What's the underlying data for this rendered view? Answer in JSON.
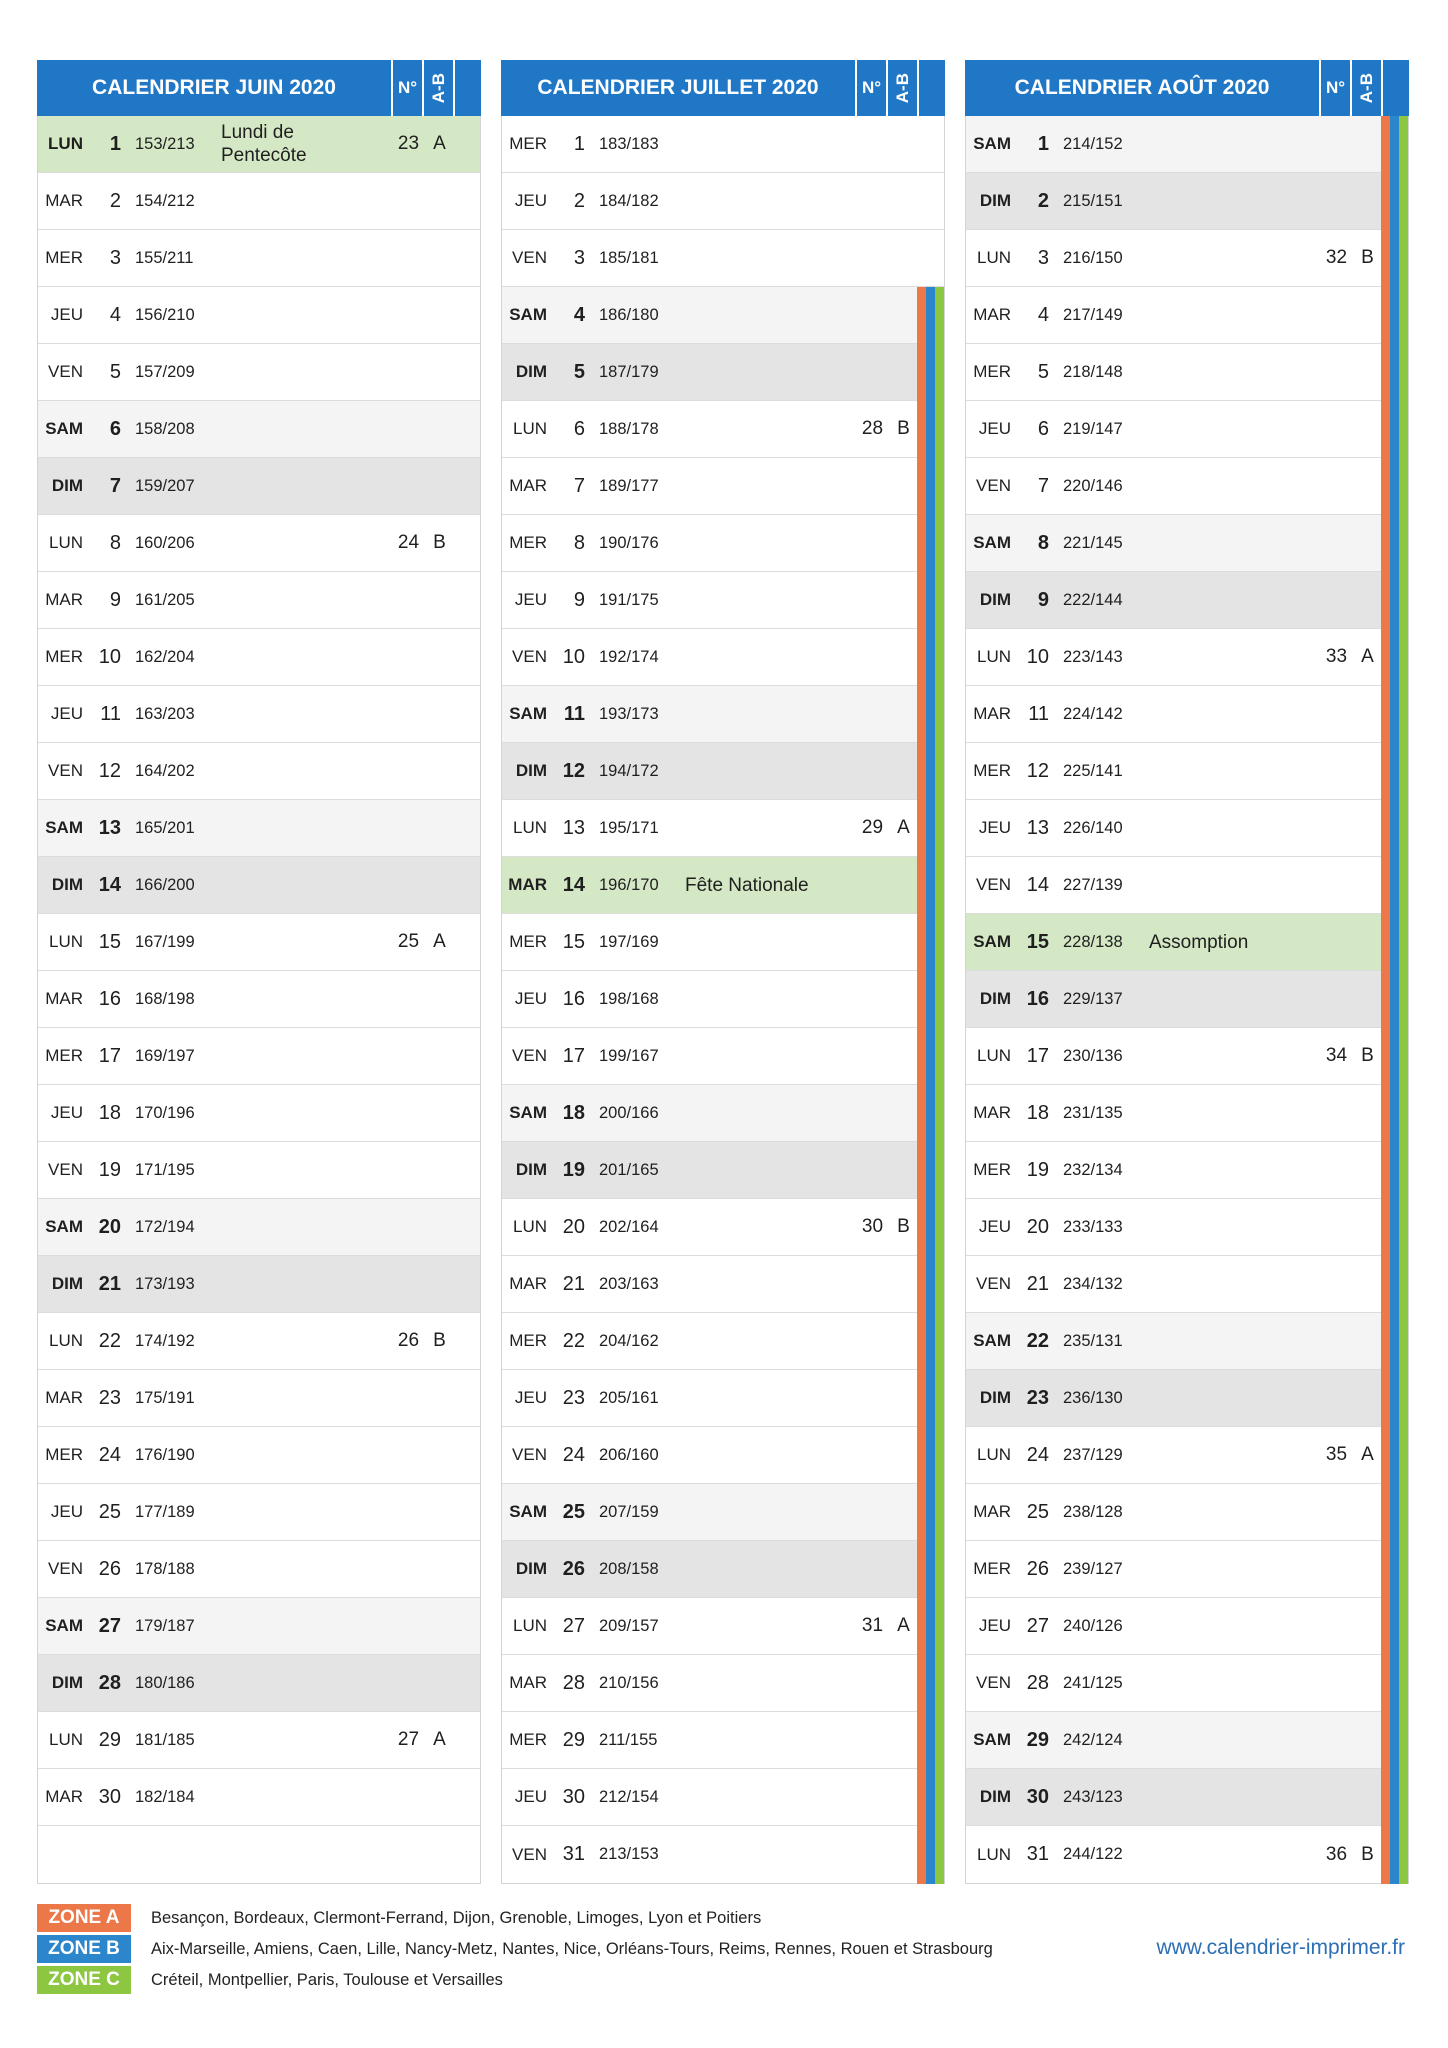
{
  "colors": {
    "header": "#2077c6",
    "saturday": "#f4f4f4",
    "sunday": "#e4e4e4",
    "holiday": "#d5e8c5",
    "website": "#2b6fb4"
  },
  "headers": {
    "week": "N°",
    "ab": "A-B"
  },
  "months": [
    {
      "title": "CALENDRIER JUIN 2020",
      "days": [
        {
          "name": "LUN",
          "num": 1,
          "doy": "153/213",
          "label": "Lundi de Pentecôte",
          "week": 23,
          "ab": "A"
        },
        {
          "name": "MAR",
          "num": 2,
          "doy": "154/212"
        },
        {
          "name": "MER",
          "num": 3,
          "doy": "155/211"
        },
        {
          "name": "JEU",
          "num": 4,
          "doy": "156/210"
        },
        {
          "name": "VEN",
          "num": 5,
          "doy": "157/209"
        },
        {
          "name": "SAM",
          "num": 6,
          "doy": "158/208"
        },
        {
          "name": "DIM",
          "num": 7,
          "doy": "159/207"
        },
        {
          "name": "LUN",
          "num": 8,
          "doy": "160/206",
          "week": 24,
          "ab": "B"
        },
        {
          "name": "MAR",
          "num": 9,
          "doy": "161/205"
        },
        {
          "name": "MER",
          "num": 10,
          "doy": "162/204"
        },
        {
          "name": "JEU",
          "num": 11,
          "doy": "163/203"
        },
        {
          "name": "VEN",
          "num": 12,
          "doy": "164/202"
        },
        {
          "name": "SAM",
          "num": 13,
          "doy": "165/201"
        },
        {
          "name": "DIM",
          "num": 14,
          "doy": "166/200"
        },
        {
          "name": "LUN",
          "num": 15,
          "doy": "167/199",
          "week": 25,
          "ab": "A"
        },
        {
          "name": "MAR",
          "num": 16,
          "doy": "168/198"
        },
        {
          "name": "MER",
          "num": 17,
          "doy": "169/197"
        },
        {
          "name": "JEU",
          "num": 18,
          "doy": "170/196"
        },
        {
          "name": "VEN",
          "num": 19,
          "doy": "171/195"
        },
        {
          "name": "SAM",
          "num": 20,
          "doy": "172/194"
        },
        {
          "name": "DIM",
          "num": 21,
          "doy": "173/193"
        },
        {
          "name": "LUN",
          "num": 22,
          "doy": "174/192",
          "week": 26,
          "ab": "B"
        },
        {
          "name": "MAR",
          "num": 23,
          "doy": "175/191"
        },
        {
          "name": "MER",
          "num": 24,
          "doy": "176/190"
        },
        {
          "name": "JEU",
          "num": 25,
          "doy": "177/189"
        },
        {
          "name": "VEN",
          "num": 26,
          "doy": "178/188"
        },
        {
          "name": "SAM",
          "num": 27,
          "doy": "179/187"
        },
        {
          "name": "DIM",
          "num": 28,
          "doy": "180/186"
        },
        {
          "name": "LUN",
          "num": 29,
          "doy": "181/185",
          "week": 27,
          "ab": "A"
        },
        {
          "name": "MAR",
          "num": 30,
          "doy": "182/184"
        }
      ]
    },
    {
      "title": "CALENDRIER JUILLET 2020",
      "days": [
        {
          "name": "MER",
          "num": 1,
          "doy": "183/183"
        },
        {
          "name": "JEU",
          "num": 2,
          "doy": "184/182"
        },
        {
          "name": "VEN",
          "num": 3,
          "doy": "185/181"
        },
        {
          "name": "SAM",
          "num": 4,
          "doy": "186/180",
          "school_holiday": true
        },
        {
          "name": "DIM",
          "num": 5,
          "doy": "187/179",
          "school_holiday": true
        },
        {
          "name": "LUN",
          "num": 6,
          "doy": "188/178",
          "week": 28,
          "ab": "B",
          "school_holiday": true
        },
        {
          "name": "MAR",
          "num": 7,
          "doy": "189/177",
          "school_holiday": true
        },
        {
          "name": "MER",
          "num": 8,
          "doy": "190/176",
          "school_holiday": true
        },
        {
          "name": "JEU",
          "num": 9,
          "doy": "191/175",
          "school_holiday": true
        },
        {
          "name": "VEN",
          "num": 10,
          "doy": "192/174",
          "school_holiday": true
        },
        {
          "name": "SAM",
          "num": 11,
          "doy": "193/173",
          "school_holiday": true
        },
        {
          "name": "DIM",
          "num": 12,
          "doy": "194/172",
          "school_holiday": true
        },
        {
          "name": "LUN",
          "num": 13,
          "doy": "195/171",
          "week": 29,
          "ab": "A",
          "school_holiday": true
        },
        {
          "name": "MAR",
          "num": 14,
          "doy": "196/170",
          "label": "Fête Nationale",
          "school_holiday": true
        },
        {
          "name": "MER",
          "num": 15,
          "doy": "197/169",
          "school_holiday": true
        },
        {
          "name": "JEU",
          "num": 16,
          "doy": "198/168",
          "school_holiday": true
        },
        {
          "name": "VEN",
          "num": 17,
          "doy": "199/167",
          "school_holiday": true
        },
        {
          "name": "SAM",
          "num": 18,
          "doy": "200/166",
          "school_holiday": true
        },
        {
          "name": "DIM",
          "num": 19,
          "doy": "201/165",
          "school_holiday": true
        },
        {
          "name": "LUN",
          "num": 20,
          "doy": "202/164",
          "week": 30,
          "ab": "B",
          "school_holiday": true
        },
        {
          "name": "MAR",
          "num": 21,
          "doy": "203/163",
          "school_holiday": true
        },
        {
          "name": "MER",
          "num": 22,
          "doy": "204/162",
          "school_holiday": true
        },
        {
          "name": "JEU",
          "num": 23,
          "doy": "205/161",
          "school_holiday": true
        },
        {
          "name": "VEN",
          "num": 24,
          "doy": "206/160",
          "school_holiday": true
        },
        {
          "name": "SAM",
          "num": 25,
          "doy": "207/159",
          "school_holiday": true
        },
        {
          "name": "DIM",
          "num": 26,
          "doy": "208/158",
          "school_holiday": true
        },
        {
          "name": "LUN",
          "num": 27,
          "doy": "209/157",
          "week": 31,
          "ab": "A",
          "school_holiday": true
        },
        {
          "name": "MAR",
          "num": 28,
          "doy": "210/156",
          "school_holiday": true
        },
        {
          "name": "MER",
          "num": 29,
          "doy": "211/155",
          "school_holiday": true
        },
        {
          "name": "JEU",
          "num": 30,
          "doy": "212/154",
          "school_holiday": true
        },
        {
          "name": "VEN",
          "num": 31,
          "doy": "213/153",
          "school_holiday": true
        }
      ]
    },
    {
      "title": "CALENDRIER AOÛT 2020",
      "days": [
        {
          "name": "SAM",
          "num": 1,
          "doy": "214/152",
          "school_holiday": true
        },
        {
          "name": "DIM",
          "num": 2,
          "doy": "215/151",
          "school_holiday": true
        },
        {
          "name": "LUN",
          "num": 3,
          "doy": "216/150",
          "week": 32,
          "ab": "B",
          "school_holiday": true
        },
        {
          "name": "MAR",
          "num": 4,
          "doy": "217/149",
          "school_holiday": true
        },
        {
          "name": "MER",
          "num": 5,
          "doy": "218/148",
          "school_holiday": true
        },
        {
          "name": "JEU",
          "num": 6,
          "doy": "219/147",
          "school_holiday": true
        },
        {
          "name": "VEN",
          "num": 7,
          "doy": "220/146",
          "school_holiday": true
        },
        {
          "name": "SAM",
          "num": 8,
          "doy": "221/145",
          "school_holiday": true
        },
        {
          "name": "DIM",
          "num": 9,
          "doy": "222/144",
          "school_holiday": true
        },
        {
          "name": "LUN",
          "num": 10,
          "doy": "223/143",
          "week": 33,
          "ab": "A",
          "school_holiday": true
        },
        {
          "name": "MAR",
          "num": 11,
          "doy": "224/142",
          "school_holiday": true
        },
        {
          "name": "MER",
          "num": 12,
          "doy": "225/141",
          "school_holiday": true
        },
        {
          "name": "JEU",
          "num": 13,
          "doy": "226/140",
          "school_holiday": true
        },
        {
          "name": "VEN",
          "num": 14,
          "doy": "227/139",
          "school_holiday": true
        },
        {
          "name": "SAM",
          "num": 15,
          "doy": "228/138",
          "label": "Assomption",
          "school_holiday": true
        },
        {
          "name": "DIM",
          "num": 16,
          "doy": "229/137",
          "school_holiday": true
        },
        {
          "name": "LUN",
          "num": 17,
          "doy": "230/136",
          "week": 34,
          "ab": "B",
          "school_holiday": true
        },
        {
          "name": "MAR",
          "num": 18,
          "doy": "231/135",
          "school_holiday": true
        },
        {
          "name": "MER",
          "num": 19,
          "doy": "232/134",
          "school_holiday": true
        },
        {
          "name": "JEU",
          "num": 20,
          "doy": "233/133",
          "school_holiday": true
        },
        {
          "name": "VEN",
          "num": 21,
          "doy": "234/132",
          "school_holiday": true
        },
        {
          "name": "SAM",
          "num": 22,
          "doy": "235/131",
          "school_holiday": true
        },
        {
          "name": "DIM",
          "num": 23,
          "doy": "236/130",
          "school_holiday": true
        },
        {
          "name": "LUN",
          "num": 24,
          "doy": "237/129",
          "week": 35,
          "ab": "A",
          "school_holiday": true
        },
        {
          "name": "MAR",
          "num": 25,
          "doy": "238/128",
          "school_holiday": true
        },
        {
          "name": "MER",
          "num": 26,
          "doy": "239/127",
          "school_holiday": true
        },
        {
          "name": "JEU",
          "num": 27,
          "doy": "240/126",
          "school_holiday": true
        },
        {
          "name": "VEN",
          "num": 28,
          "doy": "241/125",
          "school_holiday": true
        },
        {
          "name": "SAM",
          "num": 29,
          "doy": "242/124",
          "school_holiday": true
        },
        {
          "name": "DIM",
          "num": 30,
          "doy": "243/123",
          "school_holiday": true
        },
        {
          "name": "LUN",
          "num": 31,
          "doy": "244/122",
          "week": 36,
          "ab": "B",
          "school_holiday": true
        }
      ]
    }
  ],
  "legend": {
    "zones": [
      {
        "label": "ZONE A",
        "cities": "Besançon, Bordeaux, Clermont-Ferrand, Dijon, Grenoble, Limoges, Lyon et Poitiers",
        "color": "#ec7749"
      },
      {
        "label": "ZONE B",
        "cities": "Aix-Marseille, Amiens, Caen, Lille, Nancy-Metz, Nantes, Nice, Orléans-Tours, Reims, Rennes, Rouen et Strasbourg",
        "color": "#2b86cb"
      },
      {
        "label": "ZONE C",
        "cities": "Créteil, Montpellier, Paris, Toulouse et Versailles",
        "color": "#8dc641"
      }
    ]
  },
  "website": "www.calendrier-imprimer.fr"
}
